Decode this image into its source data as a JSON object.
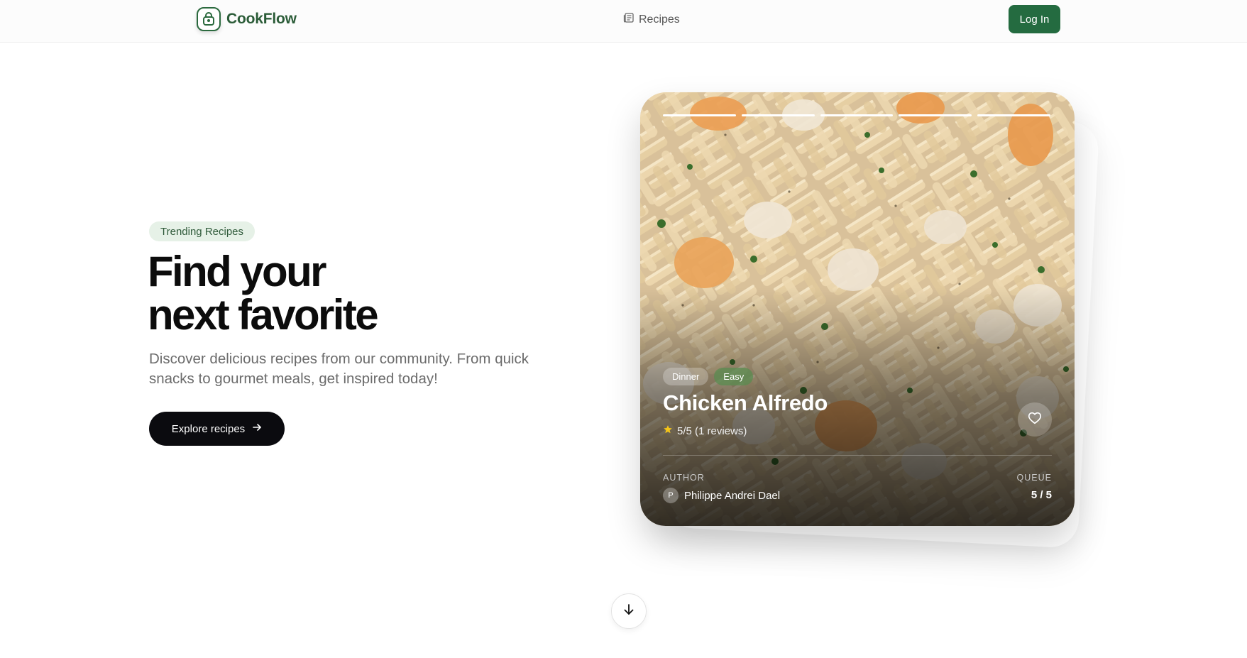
{
  "header": {
    "brand_name": "CookFlow",
    "brand_icon": "chef-lock-icon",
    "nav_recipes_label": "Recipes",
    "nav_recipes_icon": "newspaper-icon",
    "login_label": "Log In"
  },
  "hero": {
    "badge": "Trending Recipes",
    "headline_line1": "Find your",
    "headline_line2": "next favorite",
    "subtext": "Discover delicious recipes from our community. From quick snacks to gourmet meals, get inspired today!",
    "cta_label": "Explore recipes",
    "cta_icon": "arrow-right-icon"
  },
  "card": {
    "progress_segments": 5,
    "tags": [
      "Dinner",
      "Easy"
    ],
    "title": "Chicken Alfredo",
    "rating_text": "5/5 (1 reviews)",
    "rating_icon": "star-icon",
    "author_label": "AUTHOR",
    "author_initial": "P",
    "author_name": "Philippe Andrei Dael",
    "queue_label": "QUEUE",
    "queue_value": "5 / 5",
    "favorite_icon": "heart-icon"
  },
  "scroll": {
    "icon": "arrow-down-icon"
  },
  "colors": {
    "brand_green": "#246b40",
    "brand_text": "#2b5c38",
    "badge_bg": "#e6f1e7",
    "cta_bg": "#0b0b0f"
  }
}
